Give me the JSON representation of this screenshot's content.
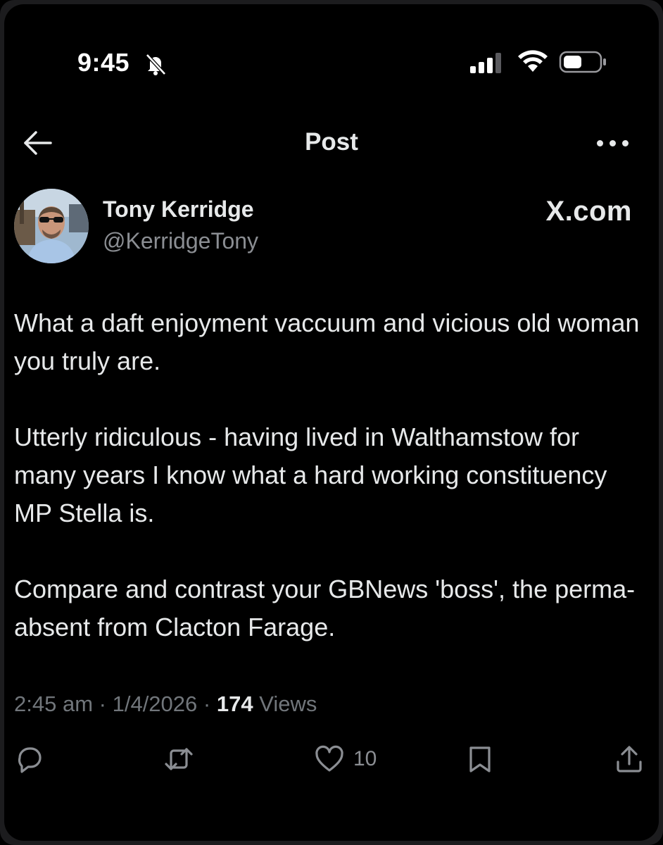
{
  "status_bar": {
    "time": "9:45",
    "icons": [
      "bell-slash-icon",
      "cellular-signal-icon",
      "wifi-icon",
      "battery-icon"
    ]
  },
  "header": {
    "title": "Post",
    "back_icon": "arrow-left-icon",
    "more_icon": "ellipsis-icon"
  },
  "author": {
    "name": "Tony Kerridge",
    "handle": "@KerridgeTony"
  },
  "watermark": "X.com",
  "post": {
    "paragraphs": [
      "What a daft enjoyment vaccuum and vicious old woman you truly are.",
      "Utterly ridiculous - having lived in Walthamstow for many years I know what a hard working constituency MP Stella is.",
      "Compare and contrast your GBNews 'boss', the perma-absent from Clacton Farage."
    ]
  },
  "meta": {
    "time": "2:45 am",
    "separator": "·",
    "date": "1/4/2026",
    "views_count": "174",
    "views_label": "Views"
  },
  "actions": {
    "reply_icon": "reply-icon",
    "repost_icon": "repost-icon",
    "like_icon": "heart-icon",
    "like_count": "10",
    "bookmark_icon": "bookmark-icon",
    "share_icon": "share-icon"
  },
  "colors": {
    "background": "#000000",
    "text_primary": "#e7e9ea",
    "text_secondary": "#71767b"
  }
}
